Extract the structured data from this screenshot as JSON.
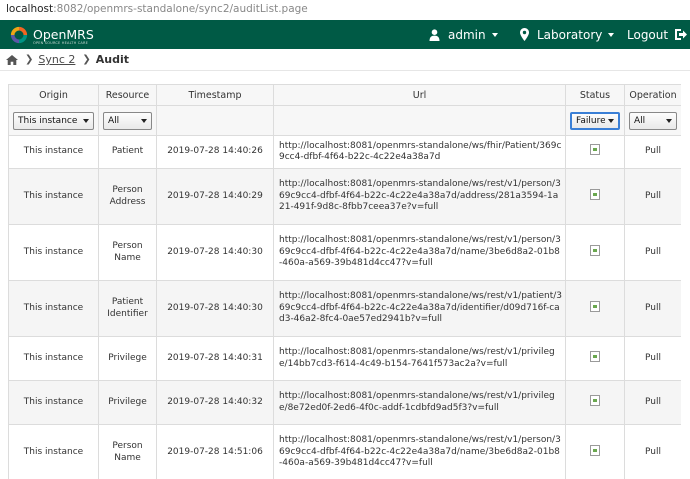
{
  "browser": {
    "url_host": "localhost",
    "url_rest": ":8082/openmrs-standalone/sync2/auditList.page"
  },
  "navbar": {
    "logo_text": "OpenMRS",
    "logo_tagline": "OPEN SOURCE HEALTH CARE",
    "user_label": "admin",
    "location_label": "Laboratory",
    "logout_label": "Logout"
  },
  "breadcrumb": {
    "parent": "Sync 2",
    "current": "Audit"
  },
  "table": {
    "headers": {
      "origin": "Origin",
      "resource": "Resource",
      "timestamp": "Timestamp",
      "url": "Url",
      "status": "Status",
      "operation": "Operation"
    },
    "filters": {
      "origin": "This instance",
      "resource": "All",
      "status": "Failure",
      "operation": "All"
    },
    "rows": [
      {
        "origin": "This instance",
        "resource": "Patient",
        "timestamp": "2019-07-28 14:40:26",
        "url": "http://localhost:8081/openmrs-standalone/ws/fhir/Patient/369c9cc4-dfbf-4f64-b22c-4c22e4a38a7d",
        "operation": "Pull"
      },
      {
        "origin": "This instance",
        "resource": "Person Address",
        "timestamp": "2019-07-28 14:40:29",
        "url": "http://localhost:8081/openmrs-standalone/ws/rest/v1/person/369c9cc4-dfbf-4f64-b22c-4c22e4a38a7d/address/281a3594-1a21-491f-9d8c-8fbb7ceea37e?v=full",
        "operation": "Pull"
      },
      {
        "origin": "This instance",
        "resource": "Person Name",
        "timestamp": "2019-07-28 14:40:30",
        "url": "http://localhost:8081/openmrs-standalone/ws/rest/v1/person/369c9cc4-dfbf-4f64-b22c-4c22e4a38a7d/name/3be6d8a2-01b8-460a-a569-39b481d4cc47?v=full",
        "operation": "Pull"
      },
      {
        "origin": "This instance",
        "resource": "Patient Identifier",
        "timestamp": "2019-07-28 14:40:30",
        "url": "http://localhost:8081/openmrs-standalone/ws/rest/v1/patient/369c9cc4-dfbf-4f64-b22c-4c22e4a38a7d/identifier/d09d716f-cad3-46a2-8fc4-0ae57ed2941b?v=full",
        "operation": "Pull"
      },
      {
        "origin": "This instance",
        "resource": "Privilege",
        "timestamp": "2019-07-28 14:40:31",
        "url": "http://localhost:8081/openmrs-standalone/ws/rest/v1/privilege/14bb7cd3-f614-4c49-b154-7641f573ac2a?v=full",
        "operation": "Pull"
      },
      {
        "origin": "This instance",
        "resource": "Privilege",
        "timestamp": "2019-07-28 14:40:32",
        "url": "http://localhost:8081/openmrs-standalone/ws/rest/v1/privilege/8e72ed0f-2ed6-4f0c-addf-1cdbfd9ad5f3?v=full",
        "operation": "Pull"
      },
      {
        "origin": "This instance",
        "resource": "Person Name",
        "timestamp": "2019-07-28 14:51:06",
        "url": "http://localhost:8081/openmrs-standalone/ws/rest/v1/person/369c9cc4-dfbf-4f64-b22c-4c22e4a38a7d/name/3be6d8a2-01b8-460a-a569-39b481d4cc47?v=full",
        "operation": "Pull"
      }
    ]
  },
  "colors": {
    "navbar_bg": "#005a45",
    "focus_border": "#3a7fd6"
  }
}
